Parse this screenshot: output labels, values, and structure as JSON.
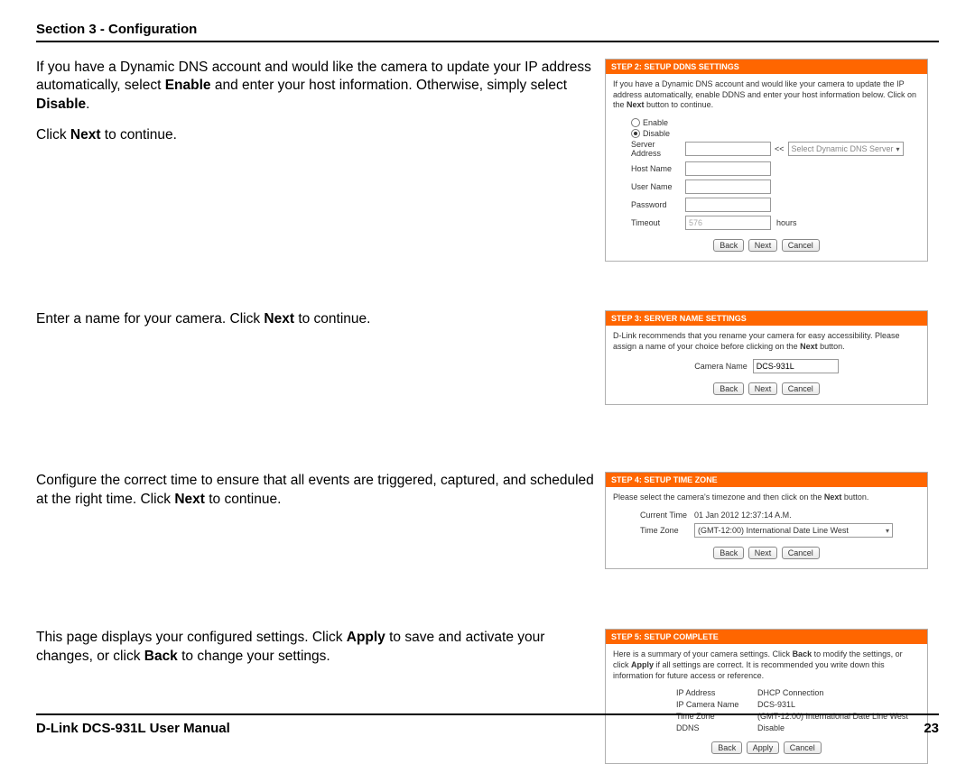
{
  "header": {
    "title": "Section 3 - Configuration"
  },
  "footer": {
    "left": "D-Link DCS-931L User Manual",
    "right": "23"
  },
  "blocks": {
    "ddns": {
      "instr_p1a": "If you have a Dynamic DNS account and would like the camera to update your IP address automatically, select ",
      "instr_p1_enable": "Enable",
      "instr_p1b": " and enter your host information. Otherwise, simply select ",
      "instr_p1_disable": "Disable",
      "instr_p1c": ".",
      "instr_p2a": "Click ",
      "instr_p2_next": "Next",
      "instr_p2b": " to continue.",
      "panel_title": "STEP 2: SETUP DDNS SETTINGS",
      "panel_desc_a": "If you have a Dynamic DNS account and would like your camera to update the IP address automatically, enable DDNS and enter your host information below. Click on the ",
      "panel_desc_next": "Next",
      "panel_desc_b": " button to continue.",
      "radio_enable": "Enable",
      "radio_disable": "Disable",
      "label_server": "Server Address",
      "server_hint": "Select Dynamic DNS Server",
      "server_chevrons": "<<",
      "label_host": "Host Name",
      "label_user": "User Name",
      "label_pass": "Password",
      "label_timeout": "Timeout",
      "timeout_val": "576",
      "timeout_unit": "hours",
      "btn_back": "Back",
      "btn_next": "Next",
      "btn_cancel": "Cancel"
    },
    "name": {
      "instr_a": "Enter a name for your camera. Click ",
      "instr_next": "Next",
      "instr_b": " to continue.",
      "panel_title": "STEP 3: SERVER NAME SETTINGS",
      "panel_desc_a": "D-Link recommends that you rename your camera for easy accessibility. Please assign a name of your choice before clicking on the ",
      "panel_desc_next": "Next",
      "panel_desc_b": " button.",
      "label_camera": "Camera Name",
      "camera_val": "DCS-931L",
      "btn_back": "Back",
      "btn_next": "Next",
      "btn_cancel": "Cancel"
    },
    "tz": {
      "instr_a": "Configure the correct time to ensure that all events are triggered, captured, and scheduled at the right time. Click ",
      "instr_next": "Next",
      "instr_b": " to continue.",
      "panel_title": "STEP 4: SETUP TIME ZONE",
      "panel_desc_a": "Please select the camera's timezone and then click on the ",
      "panel_desc_next": "Next",
      "panel_desc_b": " button.",
      "label_current": "Current Time",
      "current_val": "01 Jan 2012 12:37:14 A.M.",
      "label_zone": "Time Zone",
      "zone_val": "(GMT-12:00) International Date Line West",
      "btn_back": "Back",
      "btn_next": "Next",
      "btn_cancel": "Cancel"
    },
    "done": {
      "instr_a": "This page displays your configured settings. Click ",
      "instr_apply": "Apply",
      "instr_b": " to save and activate your changes, or click ",
      "instr_back": "Back",
      "instr_c": " to change your settings.",
      "panel_title": "STEP 5: SETUP COMPLETE",
      "panel_desc_a": "Here is a summary of your camera settings. Click ",
      "panel_desc_back": "Back",
      "panel_desc_b": " to modify the settings, or click ",
      "panel_desc_apply": "Apply",
      "panel_desc_c": " if all settings are correct. It is recommended you write down this information for future access or reference.",
      "rows": {
        "ip_k": "IP Address",
        "ip_v": "DHCP Connection",
        "cam_k": "IP Camera Name",
        "cam_v": "DCS-931L",
        "tz_k": "Time Zone",
        "tz_v": "(GMT-12:00) International Date Line West",
        "ddns_k": "DDNS",
        "ddns_v": "Disable"
      },
      "btn_back": "Back",
      "btn_apply": "Apply",
      "btn_cancel": "Cancel"
    }
  }
}
